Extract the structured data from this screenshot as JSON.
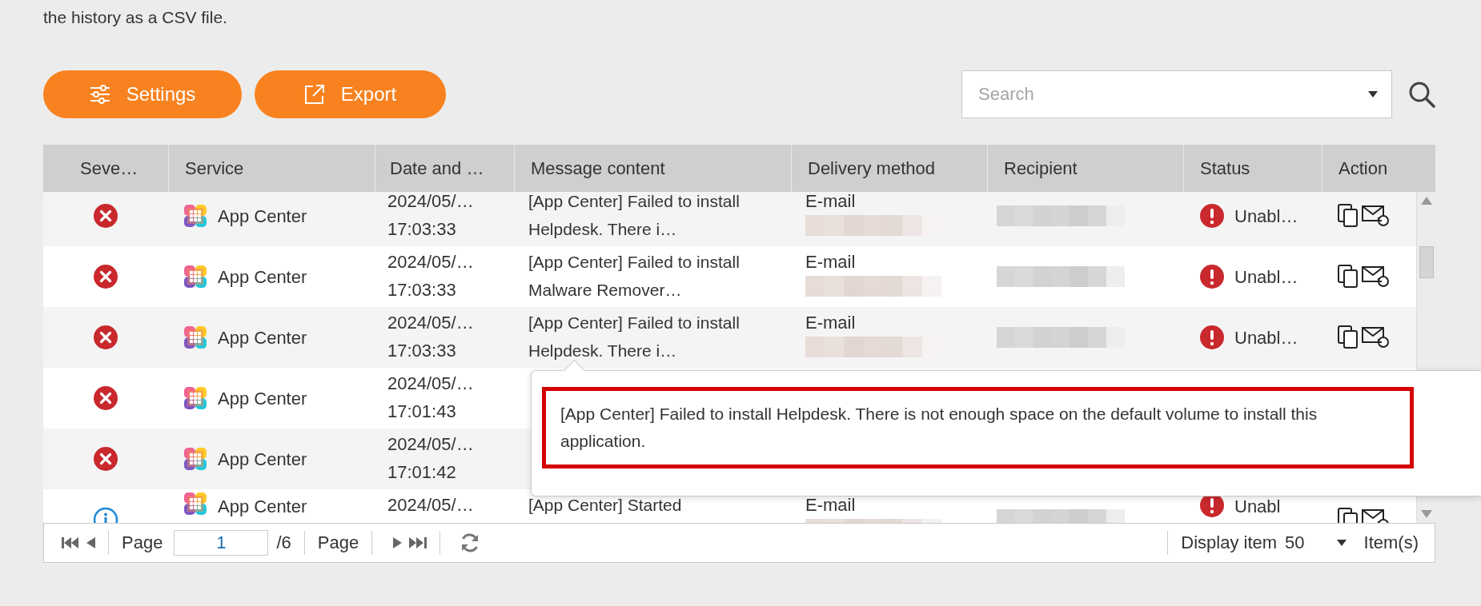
{
  "intro_text": "the history as a CSV file.",
  "toolbar": {
    "buttons": [
      {
        "label": "Settings",
        "kind": "settings"
      },
      {
        "label": "Export",
        "kind": "export"
      }
    ],
    "search": {
      "placeholder": "Search"
    }
  },
  "table": {
    "columns": [
      "Seve…",
      "Service",
      "Date and …",
      "Message content",
      "Delivery method",
      "Recipient",
      "Status",
      "Action"
    ],
    "rows": [
      {
        "kind": "error",
        "service": "App Center",
        "date": "2024/05/…",
        "time": "17:03:33",
        "message": "[App Center] Failed to install Helpdesk. There i…",
        "delivery": "E-mail",
        "status": "Unabl…"
      },
      {
        "kind": "error",
        "service": "App Center",
        "date": "2024/05/…",
        "time": "17:03:33",
        "message": "[App Center] Failed to install Malware Remover…",
        "delivery": "E-mail",
        "status": "Unabl…"
      },
      {
        "kind": "error",
        "service": "App Center",
        "date": "2024/05/…",
        "time": "17:03:33",
        "message": "[App Center] Failed to install Helpdesk. There i…",
        "delivery": "E-mail",
        "status": "Unabl…"
      },
      {
        "kind": "error",
        "service": "App Center",
        "date": "2024/05/…",
        "time": "17:01:43"
      },
      {
        "kind": "error",
        "service": "App Center",
        "date": "2024/05/…",
        "time": "17:01:42"
      },
      {
        "kind": "info",
        "service": "App Center",
        "date": "2024/05/…",
        "message": "[App Center] Started",
        "delivery": "E-mail",
        "status": "Unabl"
      }
    ]
  },
  "tooltip": {
    "text": "[App Center] Failed to install Helpdesk. There is not enough space on the default volume to install this application."
  },
  "pager": {
    "page_label": "Page",
    "page": "1",
    "total": "/6",
    "page_label_2": "Page",
    "display_label": "Display item",
    "page_size": "50",
    "unit": "Item(s)"
  }
}
